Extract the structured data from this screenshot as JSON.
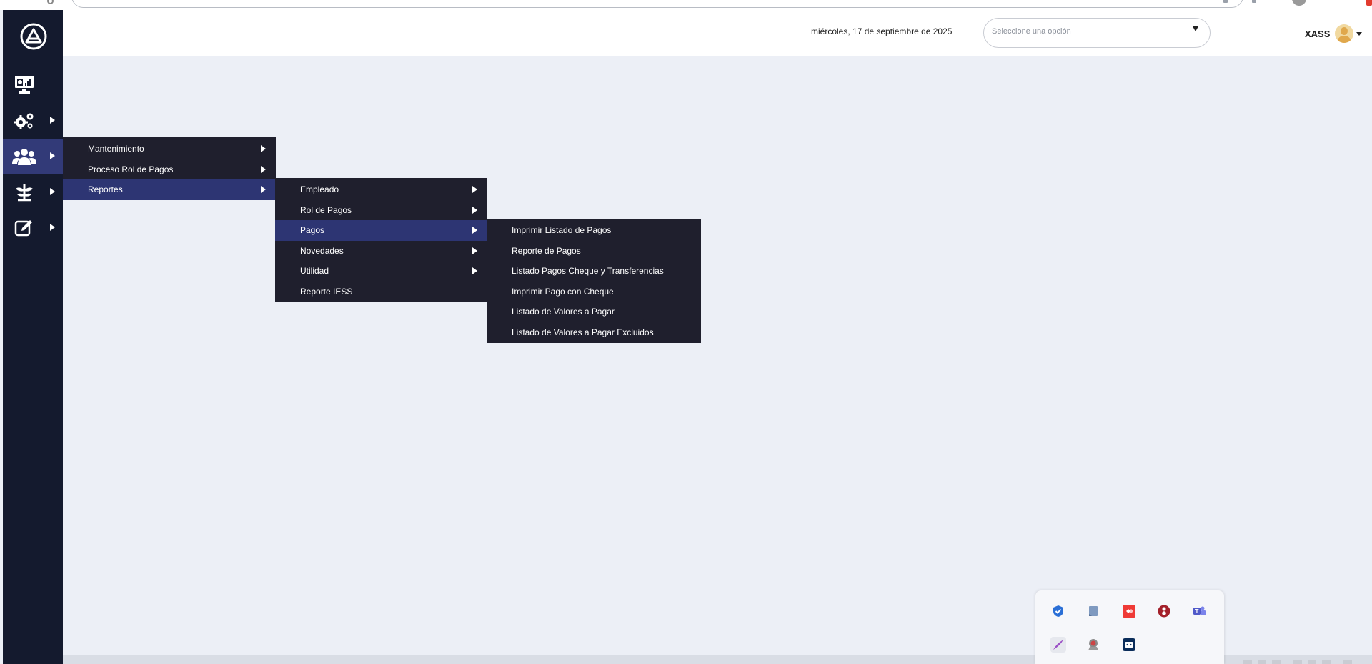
{
  "header": {
    "date": "miércoles, 17 de septiembre de 2025",
    "select_placeholder": "Seleccione una opción",
    "user_name": "XASS"
  },
  "sidebar": {
    "items": [
      {
        "icon": "dashboard-monitor-icon",
        "has_submenu": false,
        "active": false
      },
      {
        "icon": "gears-icon",
        "has_submenu": true,
        "active": false
      },
      {
        "icon": "users-group-icon",
        "has_submenu": true,
        "active": true
      },
      {
        "icon": "plant-icon",
        "has_submenu": true,
        "active": false
      },
      {
        "icon": "edit-note-icon",
        "has_submenu": true,
        "active": false
      }
    ]
  },
  "menu_level1": {
    "items": [
      {
        "label": "Mantenimiento",
        "has_submenu": true,
        "selected": false
      },
      {
        "label": "Proceso Rol de Pagos",
        "has_submenu": true,
        "selected": false
      },
      {
        "label": "Reportes",
        "has_submenu": true,
        "selected": true
      }
    ]
  },
  "menu_level2": {
    "items": [
      {
        "label": "Empleado",
        "has_submenu": true,
        "selected": false
      },
      {
        "label": "Rol de Pagos",
        "has_submenu": true,
        "selected": false
      },
      {
        "label": "Pagos",
        "has_submenu": true,
        "selected": true
      },
      {
        "label": "Novedades",
        "has_submenu": true,
        "selected": false
      },
      {
        "label": "Utilidad",
        "has_submenu": true,
        "selected": false
      },
      {
        "label": "Reporte IESS",
        "has_submenu": false,
        "selected": false
      }
    ]
  },
  "menu_level3": {
    "items": [
      {
        "label": "Imprimir Listado de Pagos"
      },
      {
        "label": "Reporte de Pagos"
      },
      {
        "label": "Listado Pagos Cheque y Transferencias"
      },
      {
        "label": "Imprimir Pago con Cheque"
      },
      {
        "label": "Listado de Valores a Pagar"
      },
      {
        "label": "Listado de Valores a Pagar Excluidos"
      }
    ]
  },
  "tray": {
    "icons": [
      "shield-check-icon",
      "note-icon",
      "anydesk-icon",
      "red-circle-app-icon",
      "teams-icon",
      "feather-pen-icon",
      "badge-icon",
      "teamviewer-icon"
    ]
  },
  "colors": {
    "sidebar_bg": "#141a2e",
    "active_item": "#323a78",
    "menu_bg": "#1f1f2d",
    "menu_selected": "#2d3573",
    "page_bg": "#eceff6"
  }
}
